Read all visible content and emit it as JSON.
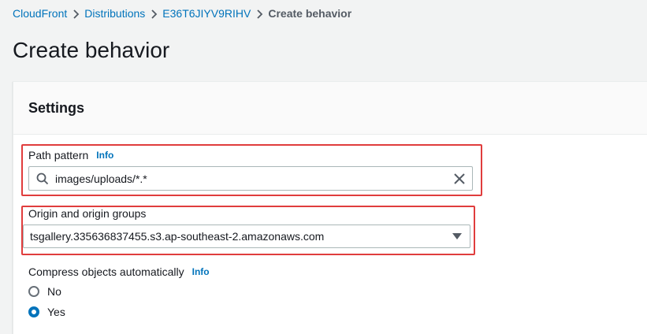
{
  "breadcrumb": {
    "items": [
      "CloudFront",
      "Distributions",
      "E36T6JIYV9RIHV"
    ],
    "current": "Create behavior"
  },
  "page": {
    "title": "Create behavior"
  },
  "settings": {
    "title": "Settings",
    "path_pattern": {
      "label": "Path pattern",
      "info": "Info",
      "value": "images/uploads/*.*"
    },
    "origin": {
      "label": "Origin and origin groups",
      "value": "tsgallery.335636837455.s3.ap-southeast-2.amazonaws.com"
    },
    "compress": {
      "label": "Compress objects automatically",
      "info": "Info",
      "options": [
        "No",
        "Yes"
      ],
      "selected": "Yes"
    }
  },
  "colors": {
    "link": "#0073bb",
    "highlight": "#e03d3d",
    "background": "#f2f3f3"
  }
}
